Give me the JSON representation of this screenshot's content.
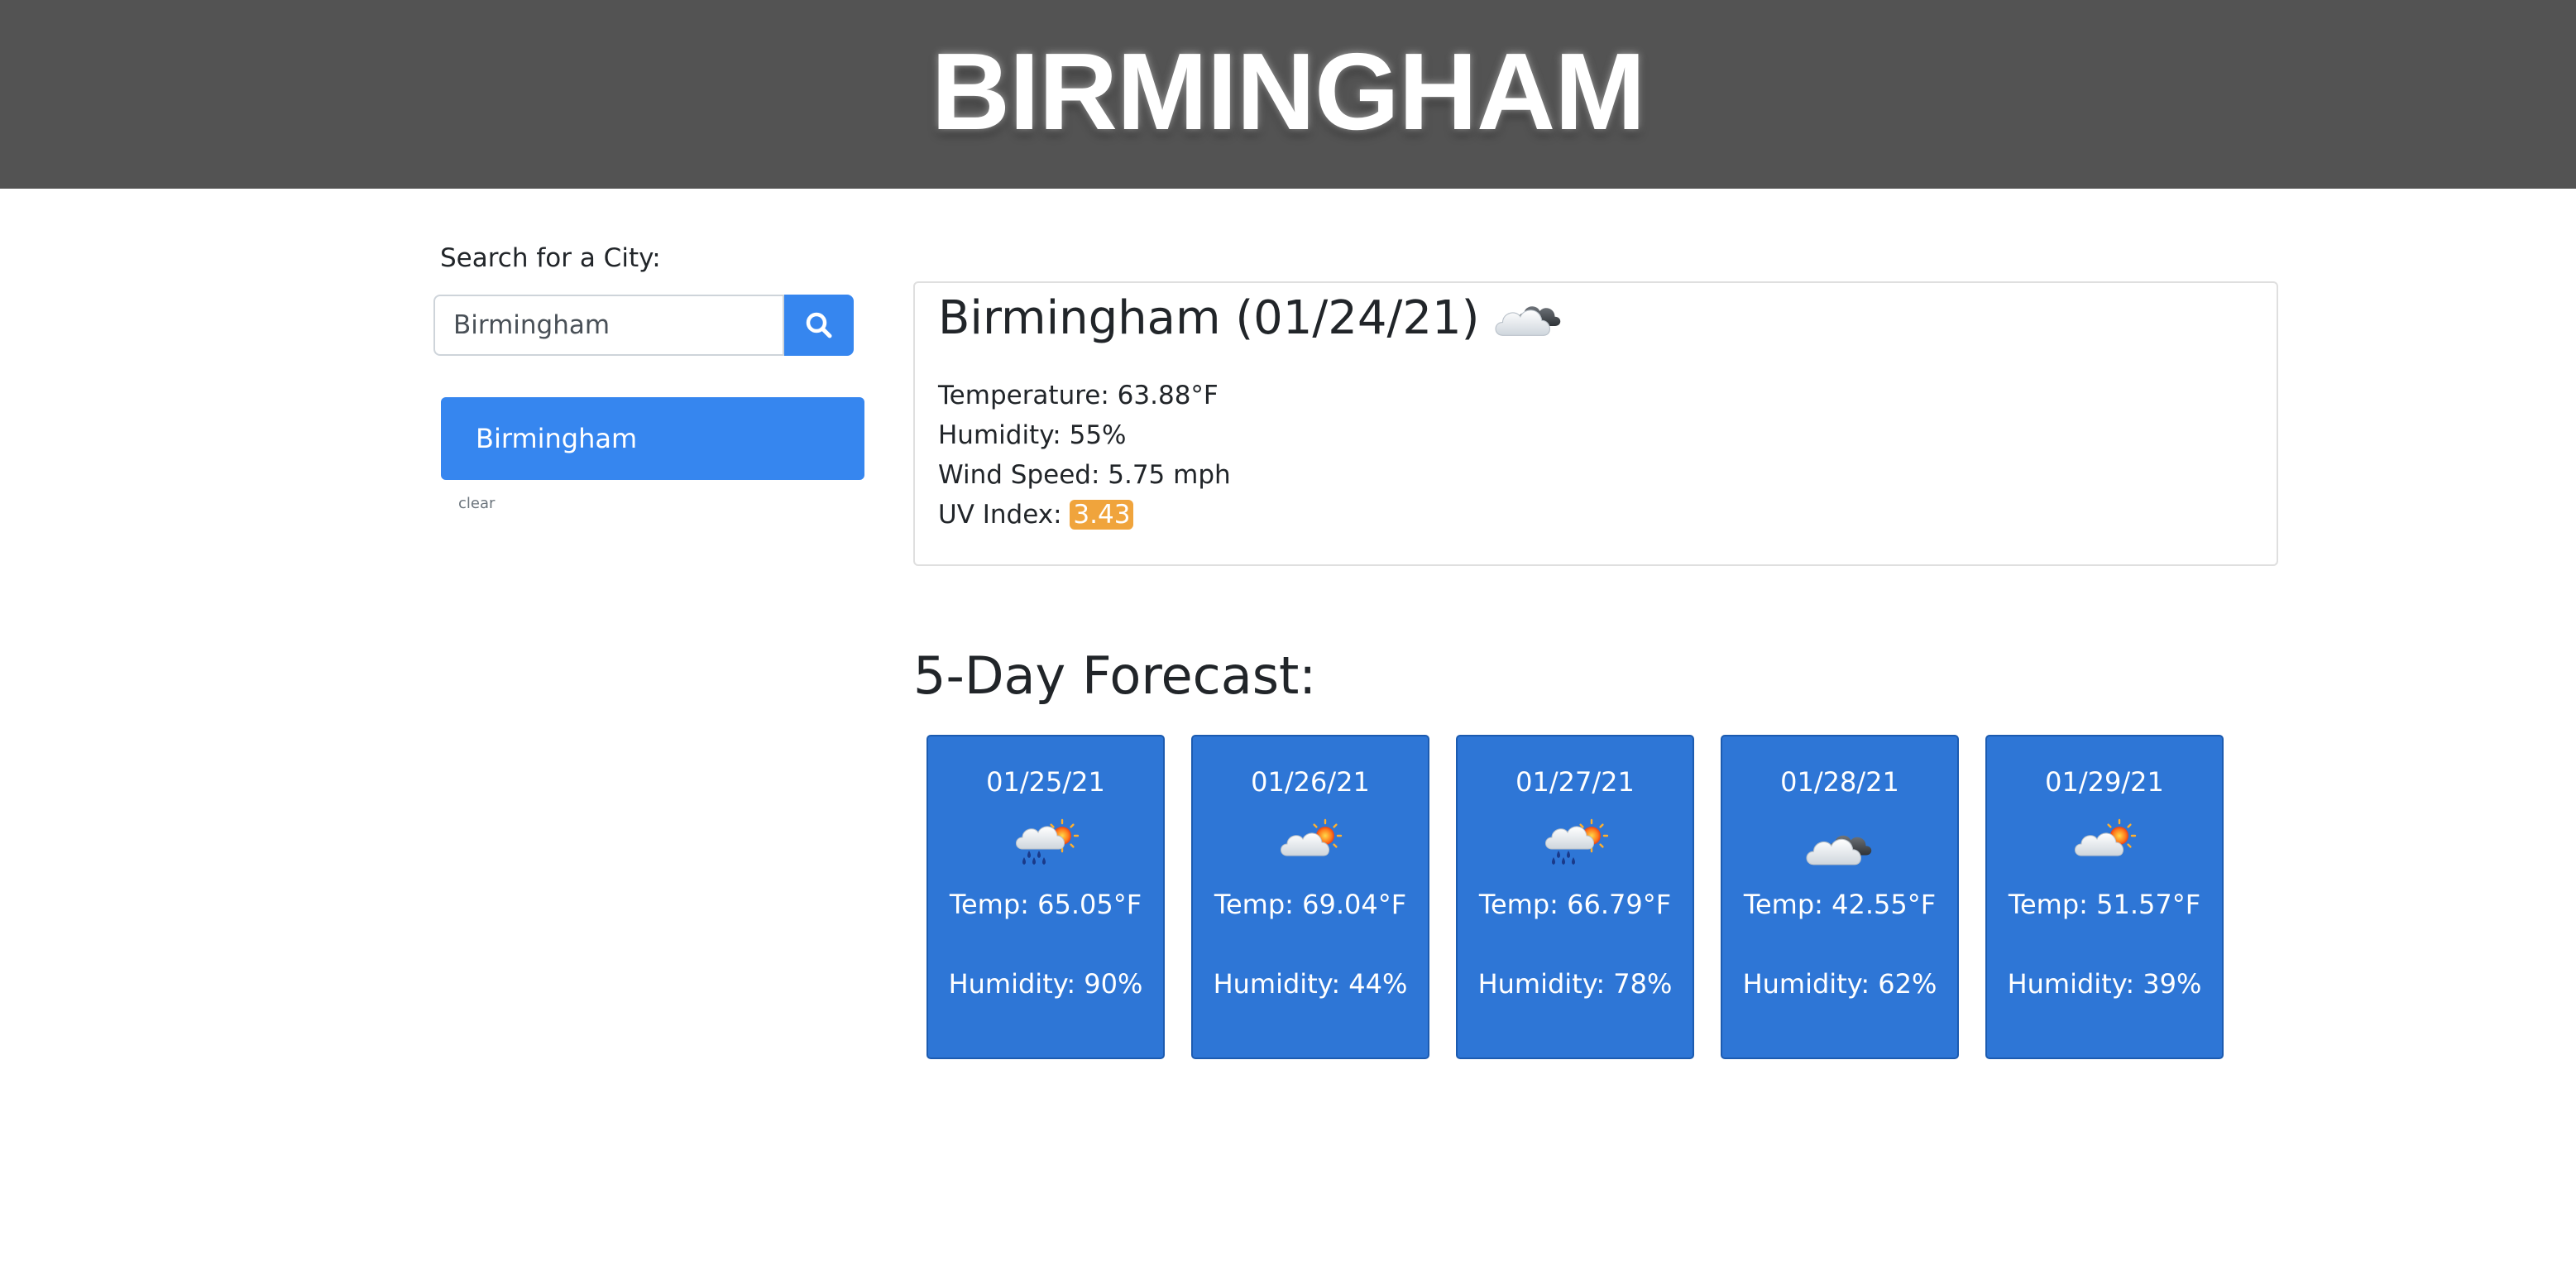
{
  "header": {
    "title": "BIRMINGHAM"
  },
  "search": {
    "label": "Search for a City:",
    "value": "Birmingham",
    "button_icon": "search-icon"
  },
  "history": {
    "items": [
      {
        "label": "Birmingham"
      }
    ],
    "clear_label": "clear"
  },
  "current": {
    "title": "Birmingham (01/24/21)",
    "icon": "cloudy-icon",
    "temperature": "Temperature: 63.88°F",
    "humidity": "Humidity: 55%",
    "wind": "Wind Speed: 5.75 mph",
    "uv_label": "UV Index: ",
    "uv_value": "3.43"
  },
  "forecast": {
    "heading": "5-Day Forecast:",
    "days": [
      {
        "date": "01/25/21",
        "icon": "rain-sun-icon",
        "temp": "Temp: 65.05°F",
        "humidity": "Humidity: 90%"
      },
      {
        "date": "01/26/21",
        "icon": "partly-cloudy-icon",
        "temp": "Temp: 69.04°F",
        "humidity": "Humidity: 44%"
      },
      {
        "date": "01/27/21",
        "icon": "rain-sun-icon",
        "temp": "Temp: 66.79°F",
        "humidity": "Humidity: 78%"
      },
      {
        "date": "01/28/21",
        "icon": "cloudy-icon",
        "temp": "Temp: 42.55°F",
        "humidity": "Humidity: 62%"
      },
      {
        "date": "01/29/21",
        "icon": "partly-cloudy-icon",
        "temp": "Temp: 51.57°F",
        "humidity": "Humidity: 39%"
      }
    ]
  },
  "colors": {
    "header_bg": "#535353",
    "accent": "#3686ef",
    "forecast_bg": "#2e76d6",
    "uv_badge": "#f0a43c"
  }
}
